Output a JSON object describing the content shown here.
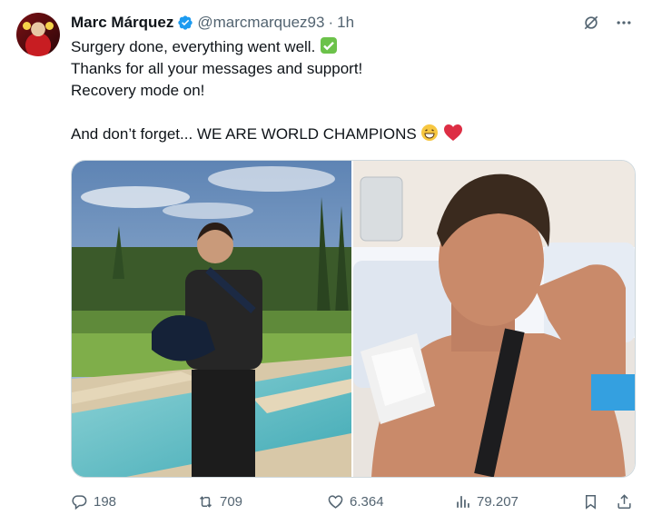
{
  "tweet": {
    "author_name": "Marc Márquez",
    "handle": "@marcmarquez93",
    "separator": "·",
    "time": "1h",
    "lines": [
      "Surgery done, everything went well.",
      "Thanks for all your messages and support!",
      "Recovery mode on!",
      "",
      "And don’t forget... WE ARE WORLD CHAMPIONS"
    ],
    "line1_emoji": "check-mark-button",
    "line5_emojis": [
      "beaming-face",
      "red-heart"
    ]
  },
  "media": {
    "left": "photo-standing-by-pool-with-arm-sling",
    "right": "photo-hospital-bed-wink-thumbs-up"
  },
  "actions": {
    "replies": "198",
    "reposts": "709",
    "likes": "6.364",
    "views": "79.207"
  },
  "colors": {
    "text": "#0f1419",
    "muted": "#536471",
    "verified": "#1d9bf0",
    "border": "#cfd9de",
    "heart": "#e0245e"
  }
}
